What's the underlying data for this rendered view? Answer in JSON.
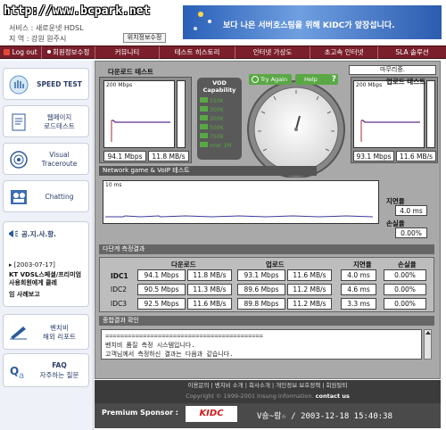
{
  "header": {
    "site_url": "http://www.bcpark.net",
    "service": "서비스 : 새로운넷 HDSL",
    "location": "지   역 : 강원 원주시",
    "change_info_label": "위치정보수정",
    "banner_text": "보다 나은 서버호스팅을 위해 KIDC가 앞장섭니다."
  },
  "menu": [
    {
      "label": "Log out",
      "icon": "logout-icon"
    },
    {
      "label": "회원정보수정"
    },
    {
      "label": "커뮤니티"
    },
    {
      "label": "테스트 히스토리"
    },
    {
      "label": "인터넷 가상도"
    },
    {
      "label": "초고속 인터넷"
    },
    {
      "label": "SLA 솔루션"
    }
  ],
  "sidebar": {
    "items": [
      {
        "label": "SPEED TEST",
        "icon": "hand-icon"
      },
      {
        "label": "웹페이지\n로드테스트",
        "icon": "document-icon"
      },
      {
        "label": "Visual\nTraceroute",
        "icon": "target-icon"
      },
      {
        "label": "Chatting",
        "icon": "people-icon"
      }
    ],
    "notice_title": "공.지.사.항.",
    "notice_date": "[2003-07-17]",
    "notice_text": "KT VDSL스페셜/프리미엄 사용회원에게 클레",
    "notice_more": "임 사례보고",
    "report": "벤치비\n해외 리포트",
    "faq_title": "FAQ",
    "faq_sub": "자주하는 질문"
  },
  "download": {
    "title": "다운로드 테스트",
    "scale_label": "200 Mbps",
    "value_mbps": "94.1 Mbps",
    "value_mbs": "11.8 MB/s"
  },
  "upload": {
    "title": "업로드 테스트",
    "scale_label": "200 Mbps",
    "value_mbps": "93.1 Mbps",
    "value_mbs": "11.6 MB/s"
  },
  "vod": {
    "title": "VOD\nCapability",
    "levels": [
      "150K",
      "300K",
      "300K",
      "500K",
      "750K",
      "over 1M"
    ]
  },
  "gauge": {
    "try_again": "Try Again",
    "help": "Help",
    "question_mark": "?",
    "top_right_label": "마무리중.",
    "needle_value": 94.1
  },
  "network": {
    "title": "Network game & VoIP 테스트",
    "scale_label": "10 ms",
    "delay_label": "지연율",
    "delay_value": "4.0 ms",
    "loss_label": "손실율",
    "loss_value": "0.00%"
  },
  "multi": {
    "title": "다단계 측정결과",
    "col_download": "다운로드",
    "col_upload": "업로드",
    "col_delay": "지연율",
    "col_loss": "손실율",
    "rows": [
      {
        "name": "IDC1",
        "dl_mbps": "94.1 Mbps",
        "dl_mbs": "11.8 MB/s",
        "ul_mbps": "93.1 Mbps",
        "ul_mbs": "11.6 MB/s",
        "delay": "4.0 ms",
        "loss": "0.00%"
      },
      {
        "name": "IDC2",
        "dl_mbps": "90.5 Mbps",
        "dl_mbs": "11.3 MB/s",
        "ul_mbps": "89.6 Mbps",
        "ul_mbs": "11.2 MB/s",
        "delay": "4.6 ms",
        "loss": "0.00%"
      },
      {
        "name": "IDC3",
        "dl_mbps": "92.5 Mbps",
        "dl_mbs": "11.6 MB/s",
        "ul_mbps": "89.8 Mbps",
        "ul_mbs": "11.2 MB/s",
        "delay": "3.3 ms",
        "loss": "0.00%"
      }
    ]
  },
  "summary": {
    "title": "종합결과 확인",
    "line1": "벤치비 품질 측정 시스템입니다.",
    "line2": "고객님께서 측정하신 결과는 다음과 같습니다."
  },
  "footer": {
    "links": "이용문의  |  벤치비 소개  |  회사소개  |  개인정보 보호정책  |  회원탈퇴",
    "copyright": "Copyright © 1999-2001 Insung Information.",
    "contact": "contact us",
    "sponsor_label": "Premium Sponsor :",
    "sponsor_logo": "KIDC",
    "watermark": "V숑~람☆ / 2003-12-18 15:40:38"
  },
  "colors": {
    "menu_bg": "#7a1f2b",
    "panel_dark": "#555555",
    "vod_green": "#5aa845",
    "banner_blue": "#2a5fb7",
    "kidc_red": "#cc1b1b"
  }
}
